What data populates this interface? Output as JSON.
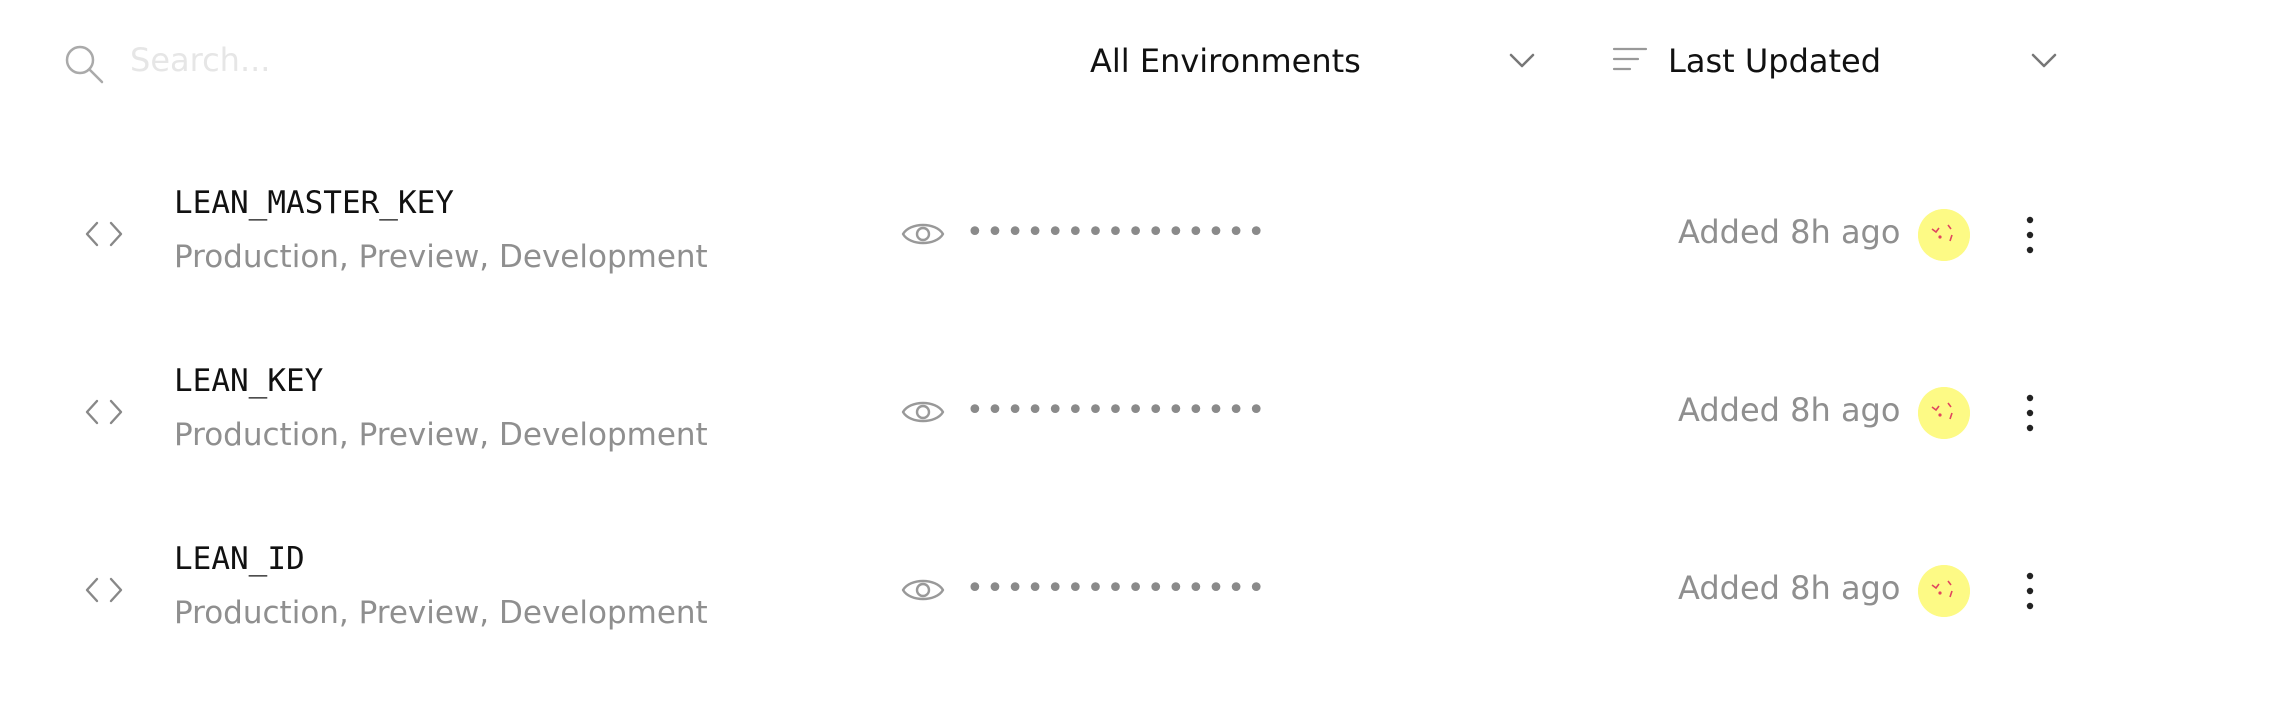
{
  "search": {
    "placeholder": "Search...",
    "icon": "search-icon"
  },
  "filters": {
    "environment": {
      "selected": "All Environments"
    },
    "sort": {
      "selected": "Last Updated",
      "icon": "sort-lines-icon"
    }
  },
  "variables": [
    {
      "name": "LEAN_MASTER_KEY",
      "environments": "Production, Preview, Development",
      "masked_value": "•••••••••••••••",
      "updated": "Added 8h ago"
    },
    {
      "name": "LEAN_KEY",
      "environments": "Production, Preview, Development",
      "masked_value": "•••••••••••••••",
      "updated": "Added 8h ago"
    },
    {
      "name": "LEAN_ID",
      "environments": "Production, Preview, Development",
      "masked_value": "•••••••••••••••",
      "updated": "Added 8h ago"
    }
  ],
  "colors": {
    "text_primary": "#111111",
    "text_secondary": "#8f8f8f",
    "icon": "#999999",
    "avatar_bg": "#fdfa85",
    "avatar_accent": "#e0455f"
  }
}
